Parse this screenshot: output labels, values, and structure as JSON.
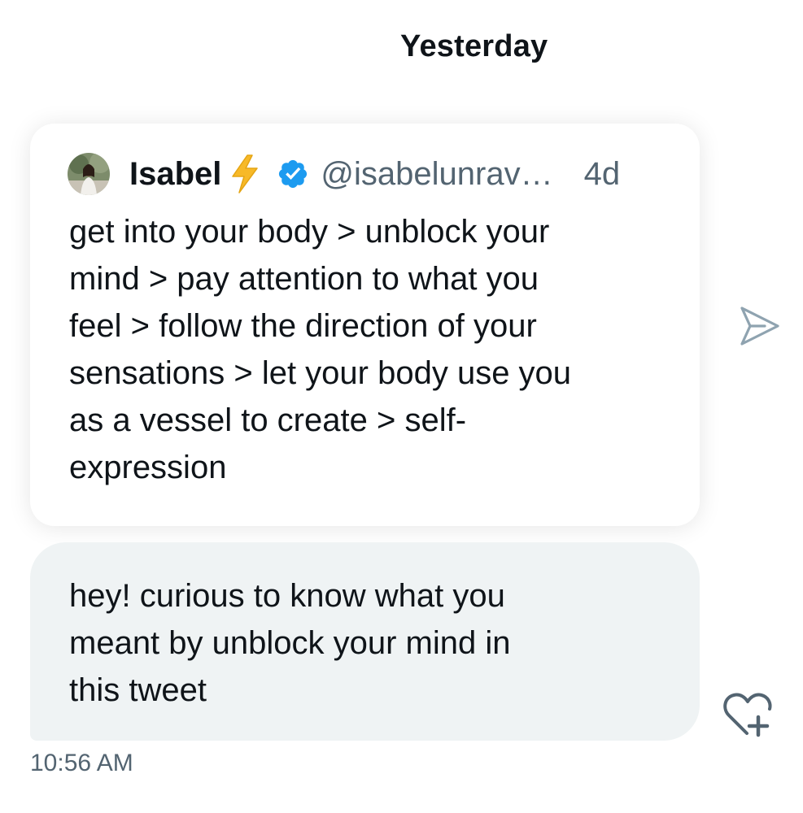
{
  "date_divider": "Yesterday",
  "quoted_tweet": {
    "author_name": "Isabel",
    "author_emoji": "⚡",
    "verified": true,
    "handle": "@isabelunrav…",
    "age": "4d",
    "text": "get into your body > unblock your\nmind > pay attention to what you\nfeel > follow the direction of your\nsensations > let your body use you\nas a vessel to create > self-\nexpression"
  },
  "message": {
    "text": "hey! curious to know what you\nmeant by unblock your mind in\nthis tweet",
    "timestamp": "10:56 AM"
  },
  "icons": {
    "share": "send-icon",
    "react": "heart-plus-icon",
    "verified": "verified-badge-icon",
    "bolt": "lightning-bolt-icon"
  },
  "colors": {
    "text_primary": "#0f1419",
    "text_secondary": "#536471",
    "verified_blue": "#1d9bf0",
    "bubble_bg": "#eff3f4",
    "bolt_yellow": "#f7b928"
  }
}
